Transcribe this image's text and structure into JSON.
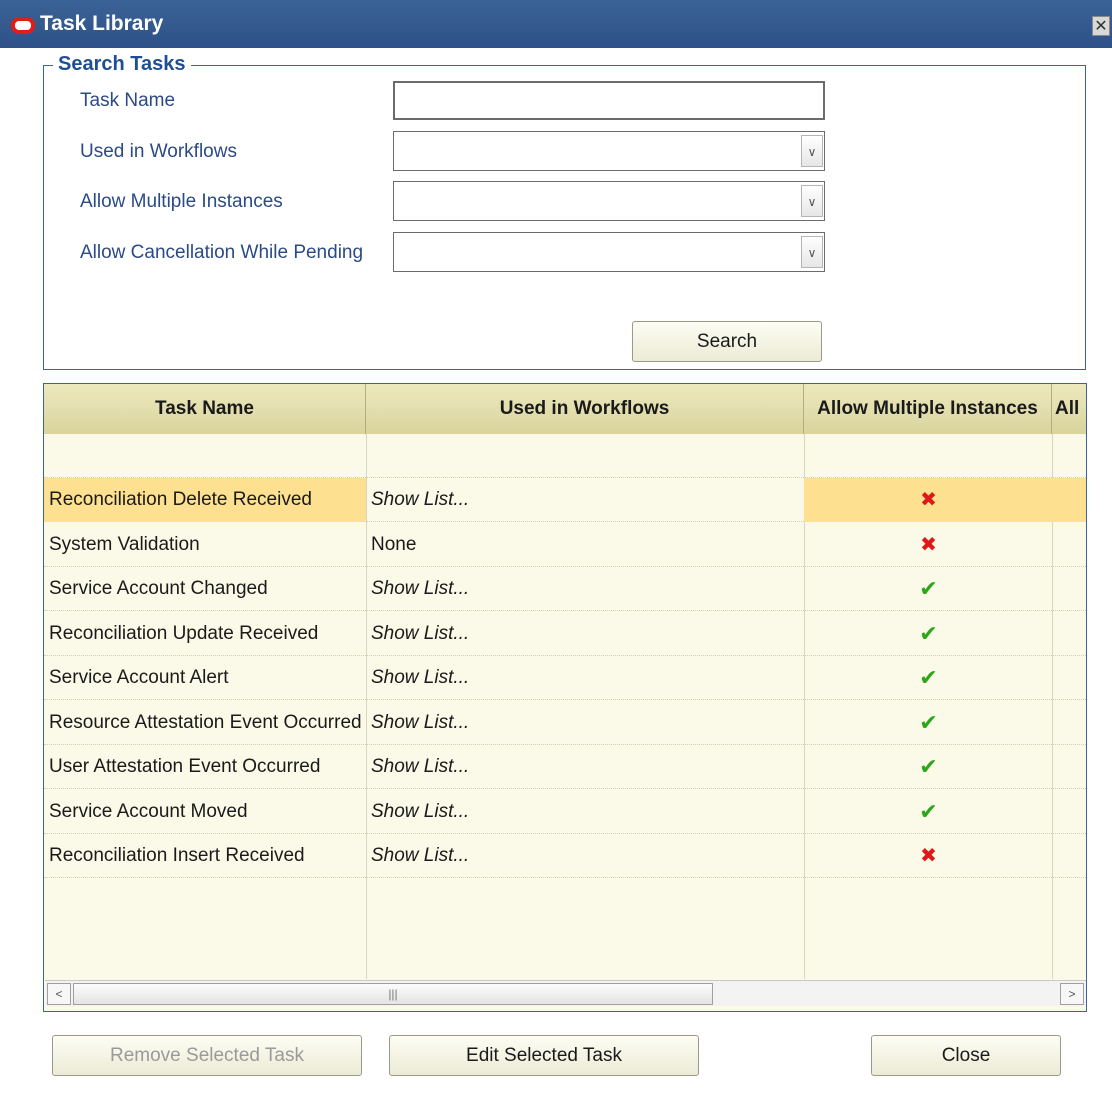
{
  "window": {
    "title": "Task Library",
    "close_icon": "close-icon"
  },
  "search": {
    "legend": "Search Tasks",
    "task_name_label": "Task Name",
    "task_name_value": "",
    "used_in_workflows_label": "Used in Workflows",
    "used_in_workflows_value": "",
    "allow_multiple_label": "Allow Multiple Instances",
    "allow_multiple_value": "",
    "allow_cancellation_label": "Allow Cancellation While Pending",
    "allow_cancellation_value": "",
    "search_button": "Search"
  },
  "table": {
    "columns": [
      "Task Name",
      "Used in Workflows",
      "Allow Multiple Instances",
      "All"
    ],
    "rows": [
      {
        "name": "Reconciliation Delete Received",
        "workflows": "Show List...",
        "multiple": "no",
        "selected": true
      },
      {
        "name": "System Validation",
        "workflows": "None",
        "multiple": "no",
        "selected": false
      },
      {
        "name": "Service Account Changed",
        "workflows": "Show List...",
        "multiple": "yes",
        "selected": false
      },
      {
        "name": "Reconciliation Update Received",
        "workflows": "Show List...",
        "multiple": "yes",
        "selected": false
      },
      {
        "name": "Service Account Alert",
        "workflows": "Show List...",
        "multiple": "yes",
        "selected": false
      },
      {
        "name": "Resource Attestation Event Occurred",
        "workflows": "Show List...",
        "multiple": "yes",
        "selected": false
      },
      {
        "name": "User Attestation Event Occurred",
        "workflows": "Show List...",
        "multiple": "yes",
        "selected": false
      },
      {
        "name": "Service Account Moved",
        "workflows": "Show List...",
        "multiple": "yes",
        "selected": false
      },
      {
        "name": "Reconciliation Insert Received",
        "workflows": "Show List...",
        "multiple": "no",
        "selected": false
      }
    ]
  },
  "actions": {
    "remove_button": "Remove Selected Task",
    "edit_button": "Edit Selected Task",
    "close_button": "Close"
  },
  "colors": {
    "titlebar": "#2d5188",
    "selection": "#fde090",
    "header": "#d9d49c",
    "check": "#2da61a",
    "cross": "#e01818"
  }
}
